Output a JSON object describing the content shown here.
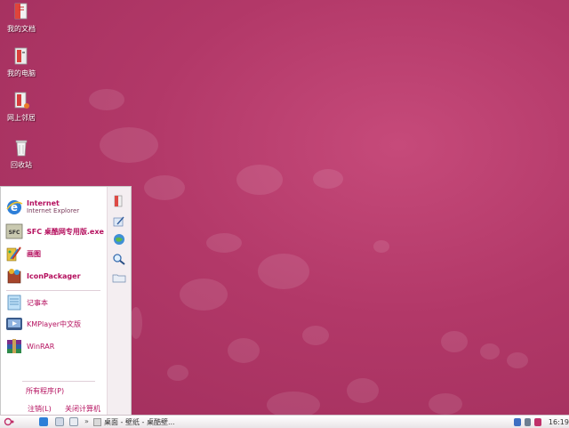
{
  "desktop": {
    "icons": [
      {
        "label": "我的文档",
        "icon": "my-documents-icon"
      },
      {
        "label": "我的电脑",
        "icon": "my-computer-icon"
      },
      {
        "label": "网上邻居",
        "icon": "network-places-icon"
      },
      {
        "label": "回收站",
        "icon": "recycle-bin-icon"
      }
    ]
  },
  "startmenu": {
    "items": [
      {
        "title": "Internet",
        "subtitle": "Internet Explorer",
        "icon": "internet-explorer-icon"
      },
      {
        "title": "SFC 桌酷网专用版.exe",
        "icon": "sfc-app-icon"
      },
      {
        "title": "画图",
        "icon": "paint-icon"
      },
      {
        "title": "IconPackager",
        "icon": "iconpackager-icon"
      },
      {
        "title": "记事本",
        "icon": "notepad-icon"
      },
      {
        "title": "KMPlayer中文版",
        "icon": "kmplayer-icon"
      },
      {
        "title": "WinRAR",
        "icon": "winrar-icon"
      }
    ],
    "all_programs": "所有程序(P)",
    "logoff": "注销(L)",
    "shutdown": "关闭计算机(U)"
  },
  "taskbar": {
    "task_label": "桌面 - 壁纸 - 桌酷壁...",
    "clock": "16:19"
  },
  "colors": {
    "accent": "#b5115f",
    "desktop": "#b23868"
  }
}
